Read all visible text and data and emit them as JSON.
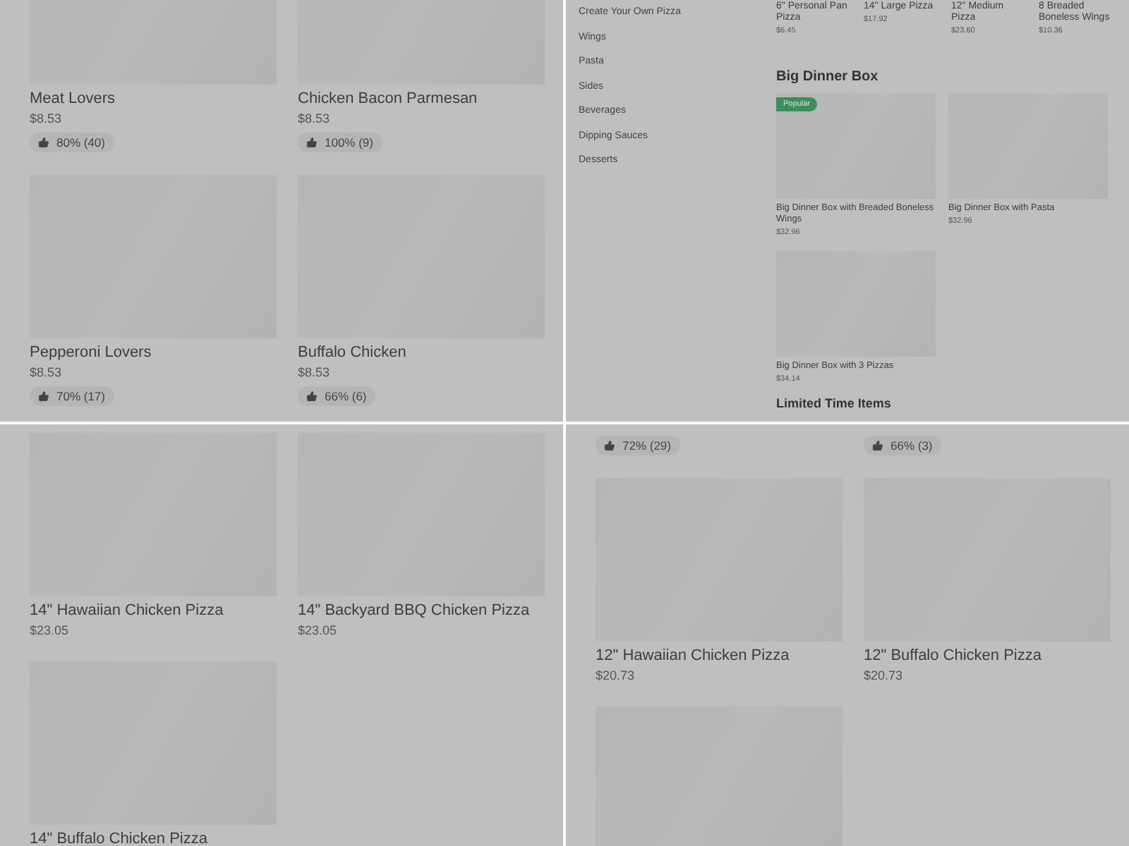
{
  "panels": [
    {
      "kind": "grid",
      "cards": [
        {
          "kind": "product",
          "name": "Meat Lovers",
          "price": "$8.53",
          "rating": "80% (40)"
        },
        {
          "kind": "product",
          "name": "Chicken Bacon Parmesan",
          "price": "$8.53",
          "rating": "100% (9)"
        },
        {
          "kind": "product",
          "name": "Pepperoni Lovers",
          "price": "$8.53",
          "rating": "70% (17)"
        },
        {
          "kind": "product",
          "name": "Buffalo Chicken",
          "price": "$8.53",
          "rating": "66% (6)"
        }
      ]
    },
    {
      "kind": "menu",
      "categories": [
        "Create Your Own Pizza",
        "Wings",
        "Pasta",
        "Sides",
        "Beverages",
        "Dipping Sauces",
        "Desserts"
      ],
      "top_items": [
        {
          "name": "6\" Personal Pan Pizza",
          "price": "$6.45"
        },
        {
          "name": "14\" Large Pizza",
          "price": "$17.92"
        },
        {
          "name": "12\" Medium Pizza",
          "price": "$23.60"
        },
        {
          "name": "8 Breaded Boneless Wings",
          "price": "$10.36"
        }
      ],
      "section": {
        "title": "Big Dinner Box",
        "items": [
          {
            "name": "Big Dinner Box with Breaded Boneless Wings",
            "price": "$32.96",
            "badge": "Popular"
          },
          {
            "name": "Big Dinner Box with Pasta",
            "price": "$32.96"
          },
          {
            "name": "Big Dinner Box with 3 Pizzas",
            "price": "$34.14"
          }
        ]
      },
      "next_section": "Limited Time Items"
    },
    {
      "kind": "grid",
      "cards": [
        {
          "kind": "product",
          "name": "14\" Hawaiian Chicken Pizza",
          "price": "$23.05"
        },
        {
          "kind": "product",
          "name": "14\" Backyard BBQ Chicken Pizza",
          "price": "$23.05"
        },
        {
          "kind": "product",
          "name": "14\" Buffalo Chicken Pizza"
        }
      ]
    },
    {
      "kind": "grid",
      "cards": [
        {
          "kind": "rating_only",
          "rating": "72% (29)"
        },
        {
          "kind": "rating_only",
          "rating": "66% (3)"
        },
        {
          "kind": "product",
          "name": "12\" Hawaiian Chicken Pizza",
          "price": "$20.73"
        },
        {
          "kind": "product",
          "name": "12\" Buffalo Chicken Pizza",
          "price": "$20.73"
        },
        {
          "kind": "product"
        }
      ]
    }
  ]
}
